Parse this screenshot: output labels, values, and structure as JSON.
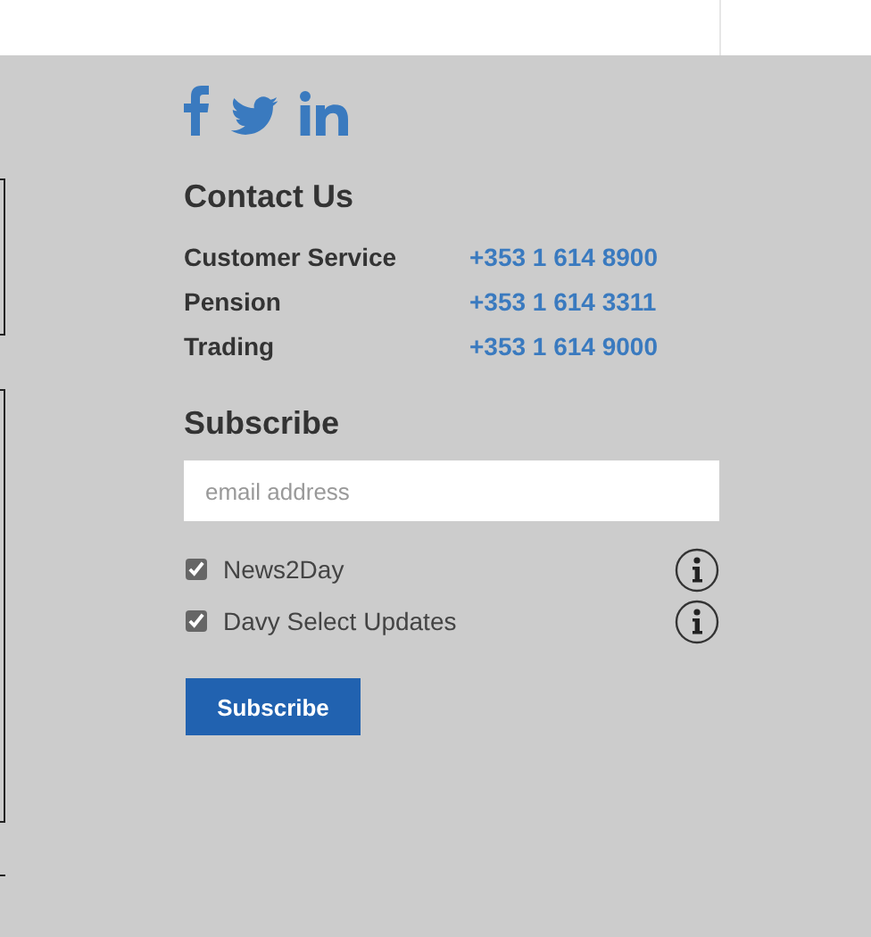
{
  "social": [
    {
      "kind": "facebook"
    },
    {
      "kind": "twitter"
    },
    {
      "kind": "linkedin"
    }
  ],
  "contact": {
    "title": "Contact Us",
    "rows": [
      {
        "label": "Customer Service",
        "phone": "+353 1 614 8900"
      },
      {
        "label": "Pension",
        "phone": "+353 1 614 3311"
      },
      {
        "label": "Trading",
        "phone": "+353 1 614 9000"
      }
    ]
  },
  "subscribe": {
    "title": "Subscribe",
    "email": {
      "placeholder": "email address"
    },
    "options": [
      {
        "label": "News2Day",
        "checked": true
      },
      {
        "label": "Davy Select Updates",
        "checked": true
      }
    ],
    "button": "Subscribe"
  }
}
